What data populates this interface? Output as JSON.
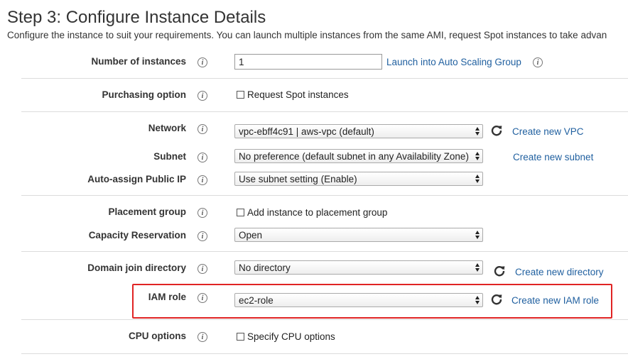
{
  "header": {
    "title": "Step 3: Configure Instance Details",
    "subtitle": "Configure the instance to suit your requirements. You can launch multiple instances from the same AMI, request Spot instances to take advan"
  },
  "info_glyph": "i",
  "form": {
    "number_of_instances": {
      "label": "Number of instances",
      "value": "1",
      "link": "Launch into Auto Scaling Group"
    },
    "purchasing_option": {
      "label": "Purchasing option",
      "checkbox_label": "Request Spot instances",
      "checked": false
    },
    "network": {
      "label": "Network",
      "selected": "vpc-ebff4c91 | aws-vpc (default)",
      "link": "Create new VPC"
    },
    "subnet": {
      "label": "Subnet",
      "selected": "No preference (default subnet in any Availability Zone)",
      "link": "Create new subnet"
    },
    "auto_assign_public_ip": {
      "label": "Auto-assign Public IP",
      "selected": "Use subnet setting (Enable)"
    },
    "placement_group": {
      "label": "Placement group",
      "checkbox_label": "Add instance to placement group",
      "checked": false
    },
    "capacity_reservation": {
      "label": "Capacity Reservation",
      "selected": "Open"
    },
    "domain_join_directory": {
      "label": "Domain join directory",
      "selected": "No directory",
      "link": "Create new directory"
    },
    "iam_role": {
      "label": "IAM role",
      "selected": "ec2-role",
      "link": "Create new IAM role"
    },
    "cpu_options": {
      "label": "CPU options",
      "checkbox_label": "Specify CPU options",
      "checked": false
    }
  },
  "colors": {
    "link": "#1f5f9f",
    "highlight": "#e02424",
    "divider": "#dcdcdc"
  }
}
